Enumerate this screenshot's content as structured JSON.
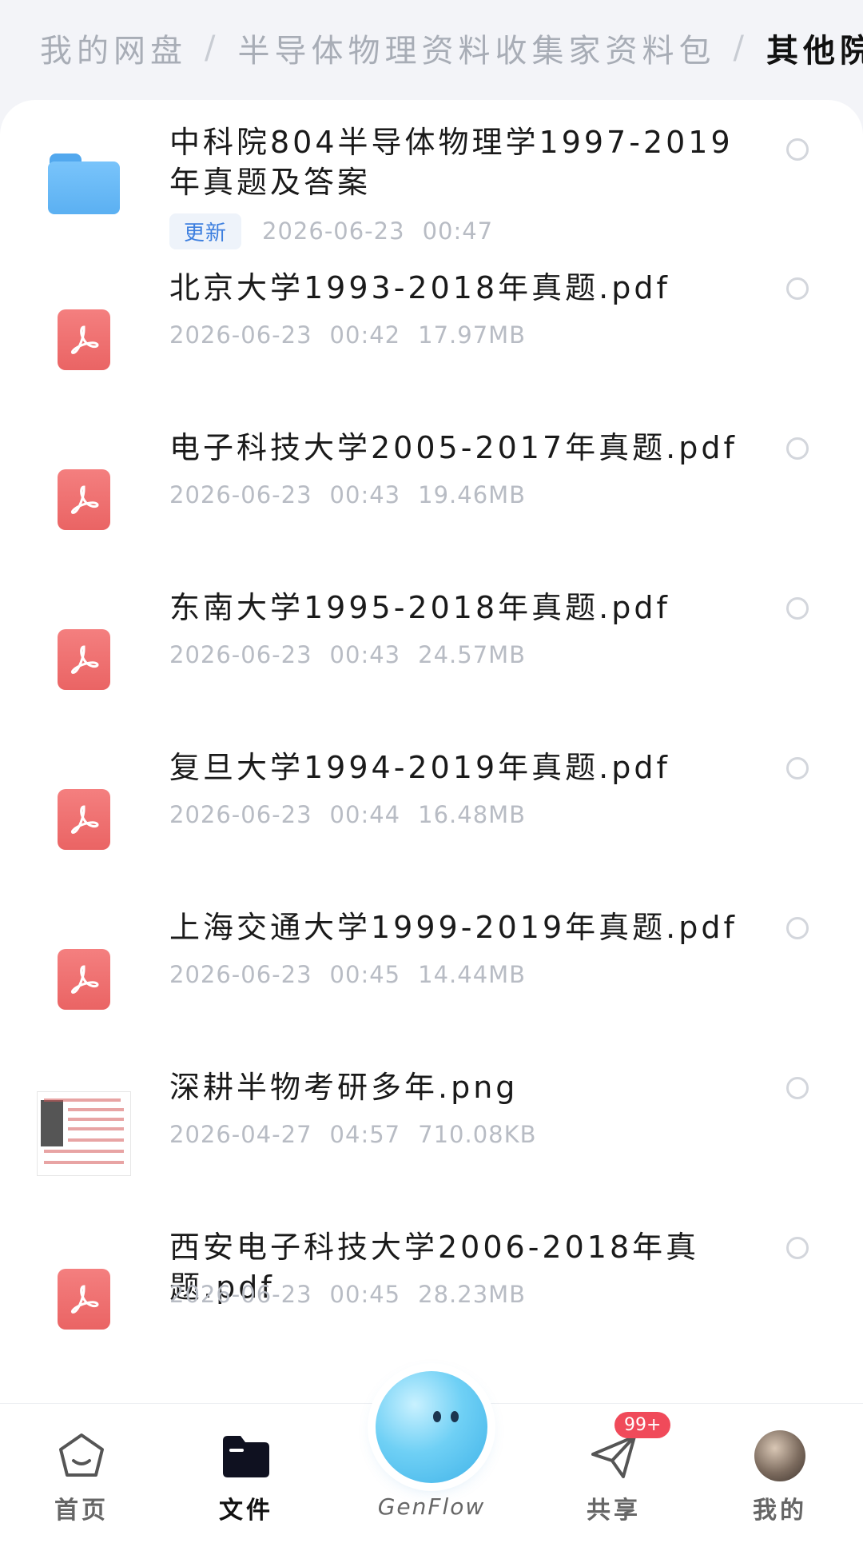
{
  "breadcrumb": {
    "items": [
      "我的网盘",
      "半导体物理资料收集家资料包"
    ],
    "current": "其他院校半",
    "separator": "/"
  },
  "files": [
    {
      "type": "folder",
      "icon": "folder-icon",
      "name": "中科院804半导体物理学1997-2019年真题及答案",
      "badge": "更新",
      "date": "2026-06-23",
      "time": "00:47",
      "size": ""
    },
    {
      "type": "pdf",
      "icon": "pdf-icon",
      "name": "北京大学1993-2018年真题.pdf",
      "date": "2026-06-23",
      "time": "00:42",
      "size": "17.97MB"
    },
    {
      "type": "pdf",
      "icon": "pdf-icon",
      "name": "电子科技大学2005-2017年真题.pdf",
      "date": "2026-06-23",
      "time": "00:43",
      "size": "19.46MB"
    },
    {
      "type": "pdf",
      "icon": "pdf-icon",
      "name": "东南大学1995-2018年真题.pdf",
      "date": "2026-06-23",
      "time": "00:43",
      "size": "24.57MB"
    },
    {
      "type": "pdf",
      "icon": "pdf-icon",
      "name": "复旦大学1994-2019年真题.pdf",
      "date": "2026-06-23",
      "time": "00:44",
      "size": "16.48MB"
    },
    {
      "type": "pdf",
      "icon": "pdf-icon",
      "name": "上海交通大学1999-2019年真题.pdf",
      "date": "2026-06-23",
      "time": "00:45",
      "size": "14.44MB"
    },
    {
      "type": "image",
      "icon": "image-thumbnail",
      "name": "深耕半物考研多年.png",
      "date": "2026-04-27",
      "time": "04:57",
      "size": "710.08KB"
    },
    {
      "type": "pdf",
      "icon": "pdf-icon",
      "name": "西安电子科技大学2006-2018年真题.pdf",
      "date": "2026-06-23",
      "time": "00:45",
      "size": "28.23MB"
    }
  ],
  "bottom_nav": {
    "home_label": "首页",
    "files_label": "文件",
    "center_label": "GenFlow",
    "share_label": "共享",
    "share_badge": "99+",
    "me_label": "我的"
  },
  "colors": {
    "pdf": "#ea6464",
    "folder": "#5bb0f2",
    "badge_text": "#3d7fdf",
    "notify": "#f04a5a"
  }
}
